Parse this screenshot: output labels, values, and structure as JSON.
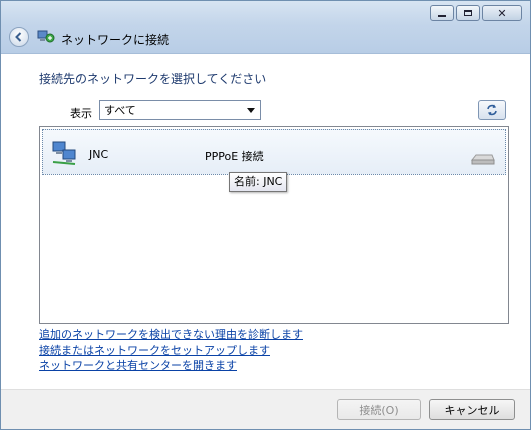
{
  "window": {
    "title": "ネットワークに接続",
    "controls": [
      "minimize-icon",
      "maximize-icon",
      "close-icon"
    ]
  },
  "instruction": "接続先のネットワークを選択してください",
  "filter": {
    "label": "表示",
    "selected": "すべて"
  },
  "networks": [
    {
      "name": "JNC",
      "type": "PPPoE 接続",
      "icon": "network-computers-icon",
      "status_icon": "dialup-signal-icon"
    }
  ],
  "tooltip": "名前: JNC",
  "links": [
    "追加のネットワークを検出できない理由を診断します",
    "接続またはネットワークをセットアップします",
    "ネットワークと共有センターを開きます"
  ],
  "buttons": {
    "connect": "接続(O)",
    "cancel": "キャンセル"
  },
  "colors": {
    "instruction": "#1e3a6e",
    "link": "#0a42a6",
    "titlebar": "#c3d5ea"
  }
}
